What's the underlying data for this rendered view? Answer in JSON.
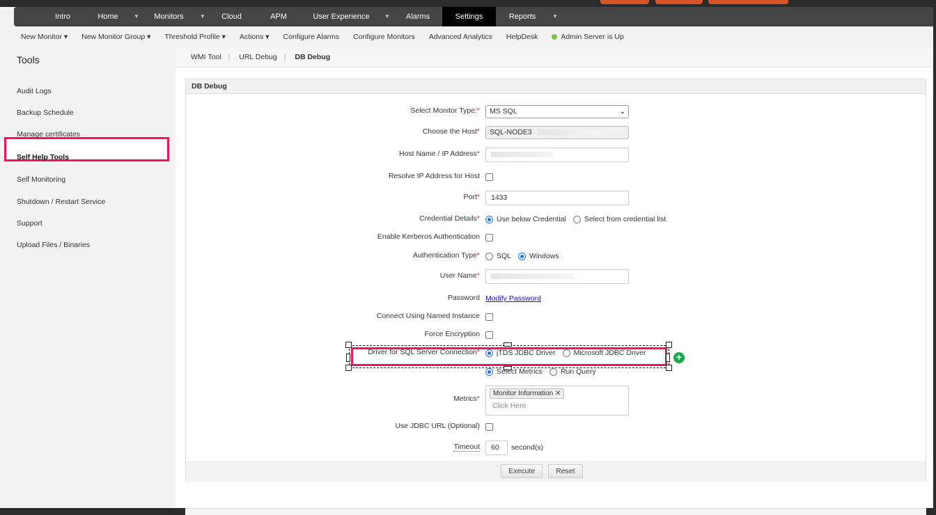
{
  "nav": {
    "items": [
      "Intro",
      "Home",
      "Monitors",
      "Cloud",
      "APM",
      "User Experience",
      "Alarms",
      "Settings",
      "Reports"
    ],
    "active": "Settings"
  },
  "subnav": {
    "items": [
      "New Monitor ▾",
      "New Monitor Group ▾",
      "Threshold Profile ▾",
      "Actions ▾",
      "Configure Alarms",
      "Configure Monitors",
      "Advanced Analytics",
      "HelpDesk"
    ],
    "status": "Admin Server is Up"
  },
  "sidebar": {
    "title": "Tools",
    "items": [
      "Audit Logs",
      "Backup Schedule",
      "Manage certificates",
      "Self Help Tools",
      "Self Monitoring",
      "Shutdown / Restart Service",
      "Support",
      "Upload Files / Binaries"
    ]
  },
  "tabs": [
    "WMI Tool",
    "URL Debug",
    "DB Debug"
  ],
  "panel": {
    "title": "DB Debug"
  },
  "form": {
    "monitor_type_label": "Select Monitor Type:",
    "monitor_type": "MS SQL",
    "host_label": "Choose the Host",
    "host": "SQL-NODE3",
    "hostname_label": "Host Name / IP Address",
    "resolve_label": "Resolve IP Address for Host",
    "port_label": "Port",
    "port": "1433",
    "cred_label": "Credential Details",
    "cred_opt1": "Use below Credential",
    "cred_opt2": "Select from credential list",
    "kerberos_label": "Enable Kerberos Authentication",
    "auth_label": "Authentication Type",
    "auth_opt1": "SQL",
    "auth_opt2": "Windows",
    "user_label": "User Name",
    "password_label": "Password",
    "password_link": "Modify Password",
    "named_label": "Connect Using Named Instance",
    "encrypt_label": "Force Encryption",
    "driver_label": "Driver for SQL Server Connection",
    "driver_opt1": "jTDS JDBC Driver",
    "driver_opt2": "Microsoft JDBC Driver",
    "mode_opt1": "Select Metrics",
    "mode_opt2": "Run Query",
    "metrics_label": "Metrics",
    "metrics_tag": "Monitor Information",
    "metrics_placeholder": "Click Here",
    "jdbc_label": "Use JDBC URL (Optional)",
    "timeout_label": "Timeout",
    "timeout": "60",
    "timeout_unit": "second(s)",
    "execute": "Execute",
    "reset": "Reset"
  }
}
